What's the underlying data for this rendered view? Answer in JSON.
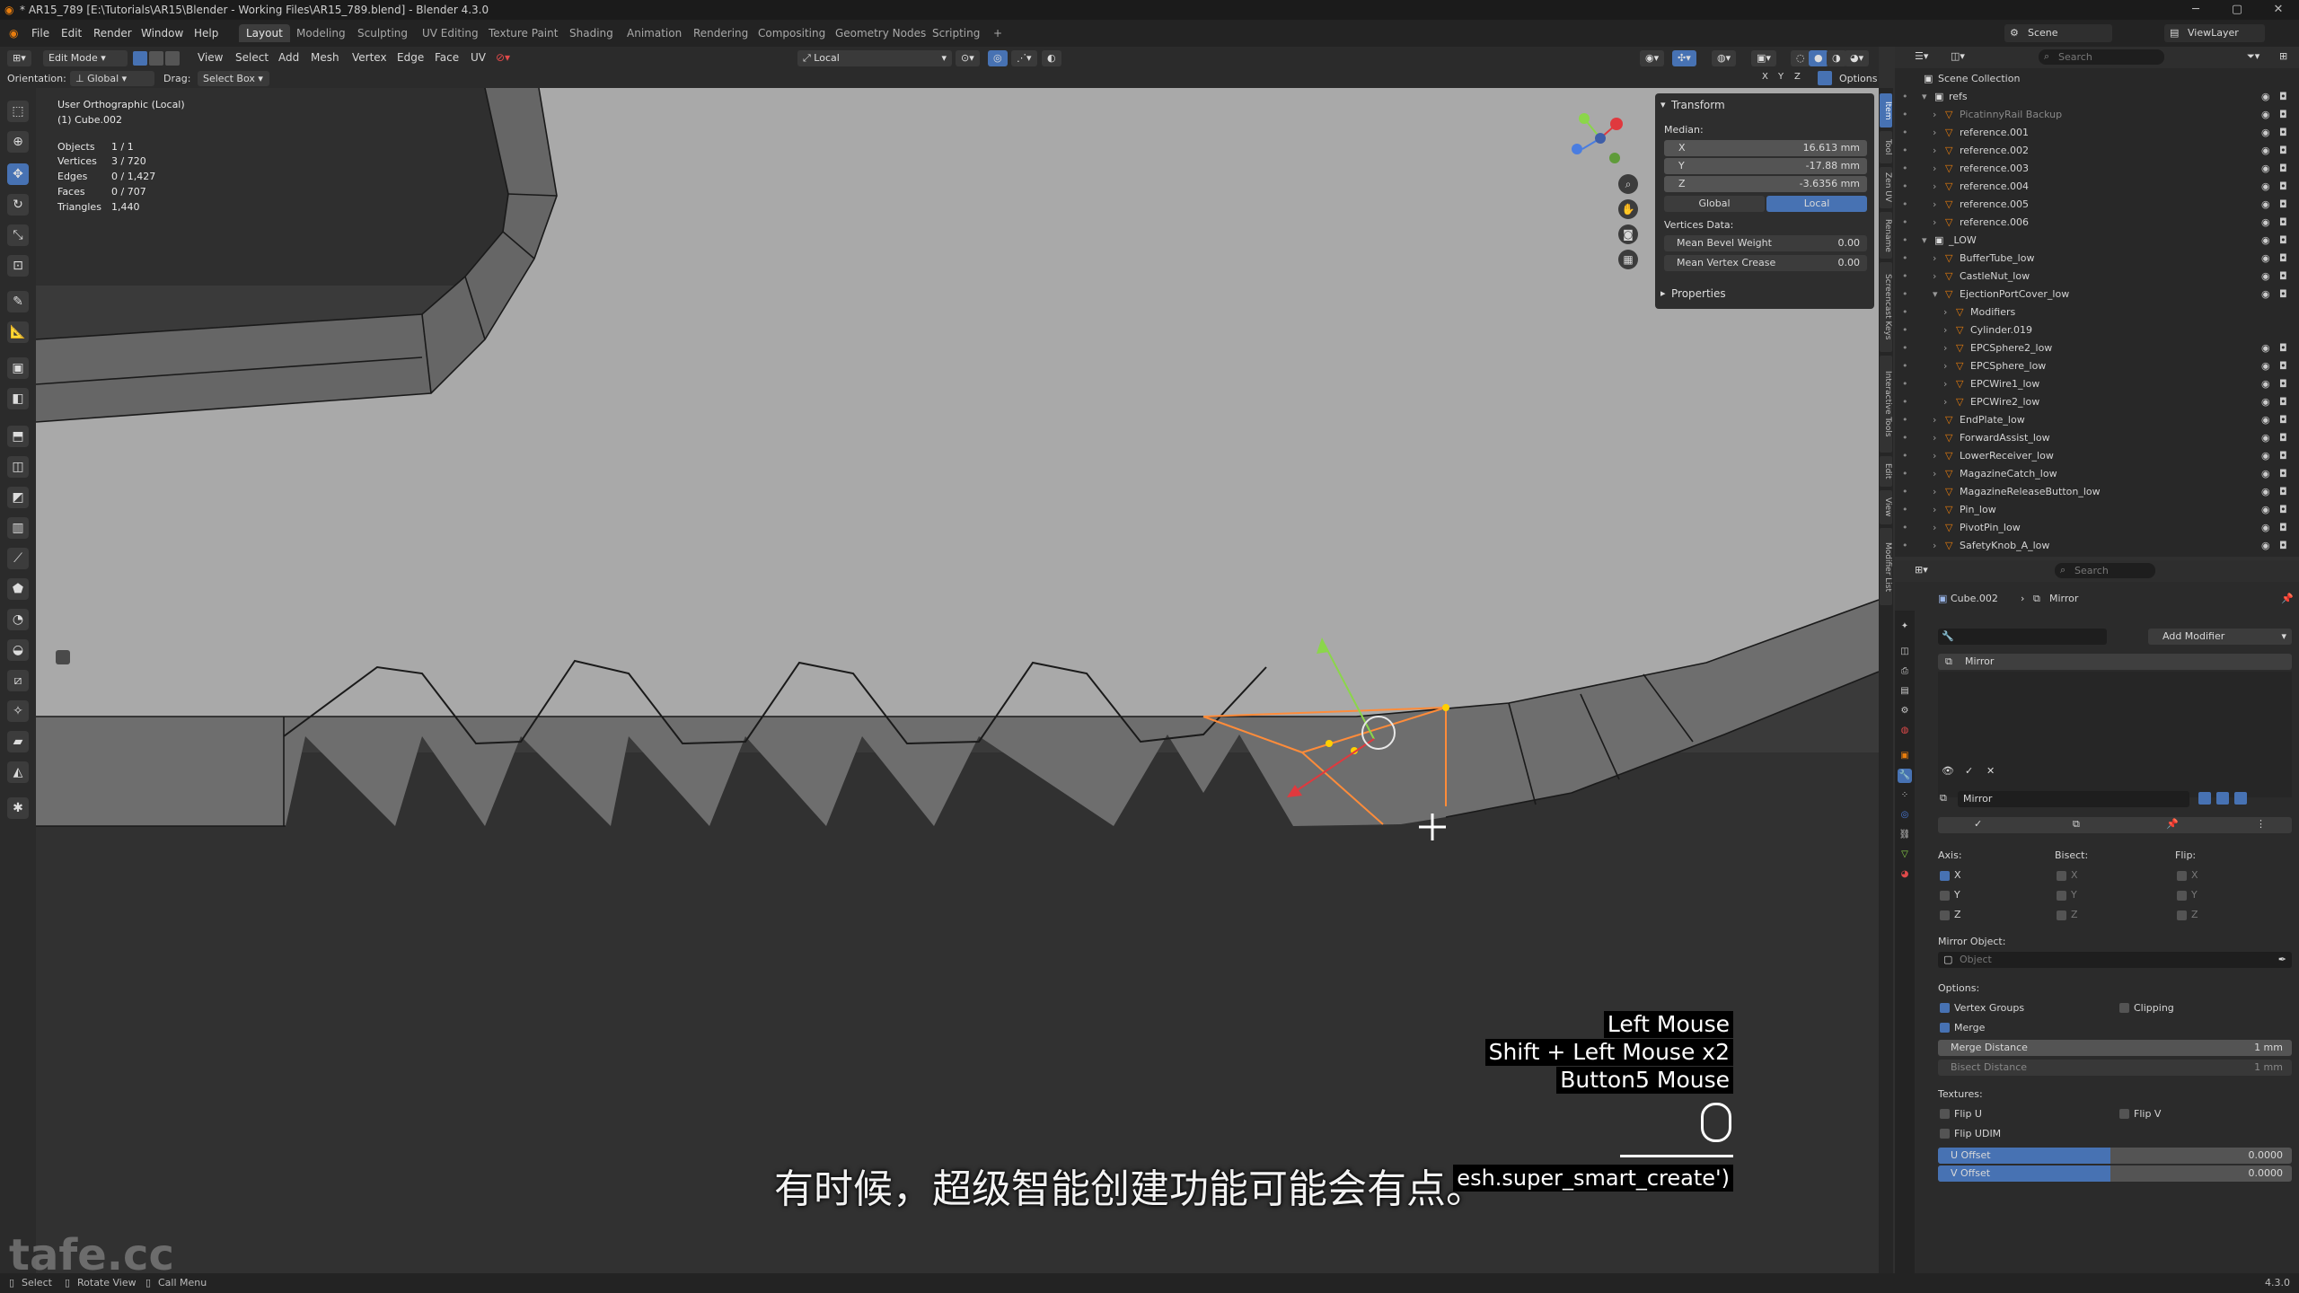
{
  "titlebar": {
    "title": "* AR15_789 [E:\\Tutorials\\AR15\\Blender - Working Files\\AR15_789.blend] - Blender 4.3.0"
  },
  "menu": {
    "items": [
      "File",
      "Edit",
      "Render",
      "Window",
      "Help"
    ]
  },
  "workspaces": [
    "Layout",
    "Modeling",
    "Sculpting",
    "UV Editing",
    "Texture Paint",
    "Shading",
    "Animation",
    "Rendering",
    "Compositing",
    "Geometry Nodes",
    "Scripting",
    "+"
  ],
  "topright": {
    "scene": "Scene",
    "viewlayer": "ViewLayer"
  },
  "header": {
    "mode": "Edit Mode",
    "menus": [
      "View",
      "Select",
      "Add",
      "Mesh",
      "Vertex",
      "Edge",
      "Face",
      "UV"
    ],
    "orientation_label": "Orientation:",
    "orientation": "Global",
    "drag_label": "Drag:",
    "drag": "Select Box",
    "pivot": "Local",
    "options": "Options",
    "axes": [
      "X",
      "Y",
      "Z"
    ]
  },
  "overlay": {
    "view_name": "User Orthographic (Local)",
    "object_name": "(1) Cube.002",
    "stats": [
      {
        "label": "Objects",
        "value": "1 / 1"
      },
      {
        "label": "Vertices",
        "value": "3 / 720"
      },
      {
        "label": "Edges",
        "value": "0 / 1,427"
      },
      {
        "label": "Faces",
        "value": "0 / 707"
      },
      {
        "label": "Triangles",
        "value": "1,440"
      }
    ]
  },
  "npanel": {
    "transform": "Transform",
    "median": "Median:",
    "x_label": "X",
    "x": "16.613 mm",
    "y_label": "Y",
    "y": "-17.88 mm",
    "z_label": "Z",
    "z": "-3.6356 mm",
    "global": "Global",
    "local": "Local",
    "vertices_data": "Vertices Data:",
    "bevel_label": "Mean Bevel Weight",
    "bevel": "0.00",
    "crease_label": "Mean Vertex Crease",
    "crease": "0.00",
    "properties": "Properties"
  },
  "sidetabs": [
    "Item",
    "Tool",
    "Zen UV",
    "Rename",
    "Screencast Keys",
    "Interactive Tools",
    "Edit",
    "View",
    "Modifier List"
  ],
  "outliner": {
    "search_placeholder": "Search",
    "rows": [
      {
        "name": "Scene Collection",
        "indent": 0
      },
      {
        "name": "refs",
        "indent": 1
      },
      {
        "name": "PicatinnyRail Backup",
        "indent": 2
      },
      {
        "name": "reference.001",
        "indent": 2
      },
      {
        "name": "reference.002",
        "indent": 2
      },
      {
        "name": "reference.003",
        "indent": 2
      },
      {
        "name": "reference.004",
        "indent": 2
      },
      {
        "name": "reference.005",
        "indent": 2
      },
      {
        "name": "reference.006",
        "indent": 2
      },
      {
        "name": "_LOW",
        "indent": 1
      },
      {
        "name": "BufferTube_low",
        "indent": 2
      },
      {
        "name": "CastleNut_low",
        "indent": 2
      },
      {
        "name": "EjectionPortCover_low",
        "indent": 2
      },
      {
        "name": "Modifiers",
        "indent": 3
      },
      {
        "name": "Cylinder.019",
        "indent": 3
      },
      {
        "name": "EPCSphere2_low",
        "indent": 3
      },
      {
        "name": "EPCSphere_low",
        "indent": 3
      },
      {
        "name": "EPCWire1_low",
        "indent": 3
      },
      {
        "name": "EPCWire2_low",
        "indent": 3
      },
      {
        "name": "EndPlate_low",
        "indent": 2
      },
      {
        "name": "ForwardAssist_low",
        "indent": 2
      },
      {
        "name": "LowerReceiver_low",
        "indent": 2
      },
      {
        "name": "MagazineCatch_low",
        "indent": 2
      },
      {
        "name": "MagazineReleaseButton_low",
        "indent": 2
      },
      {
        "name": "Pin_low",
        "indent": 2
      },
      {
        "name": "PivotPin_low",
        "indent": 2
      },
      {
        "name": "SafetyKnob_A_low",
        "indent": 2
      }
    ]
  },
  "properties": {
    "search_placeholder": "Search",
    "breadcrumb_object": "Cube.002",
    "breadcrumb_modifier": "Mirror",
    "add_modifier": "Add Modifier",
    "modifier_list_item": "Mirror",
    "modifier_name": "Mirror",
    "axis_label": "Axis:",
    "bisect_label": "Bisect:",
    "flip_label": "Flip:",
    "axes": [
      "X",
      "Y",
      "Z"
    ],
    "axis_checked": [
      true,
      false,
      false
    ],
    "mirror_object_label": "Mirror Object:",
    "object_placeholder": "Object",
    "options_label": "Options:",
    "vertex_groups": "Vertex Groups",
    "clipping": "Clipping",
    "merge": "Merge",
    "merge_distance_label": "Merge Distance",
    "merge_distance": "1 mm",
    "bisect_distance_label": "Bisect Distance",
    "bisect_distance": "1 mm",
    "textures_label": "Textures:",
    "flip_u": "Flip U",
    "flip_v": "Flip V",
    "flip_udim": "Flip UDIM",
    "u_offset_label": "U Offset",
    "u_offset": "0.0000",
    "v_offset_label": "V Offset",
    "v_offset": "0.0000"
  },
  "statusbar": {
    "select": "Select",
    "rotate": "Rotate View",
    "call_menu": "Call Menu",
    "version": "4.3.0"
  },
  "captions": {
    "keys": [
      "Left Mouse",
      "Shift + Left Mouse x2",
      "Button5 Mouse"
    ],
    "operator": "esh.super_smart_create')",
    "subtitle": "有时候，超级智能创建功能可能会有点。",
    "watermark": "tafe.cc"
  },
  "colors": {
    "accent": "#4772b3",
    "selection": "#ff8c3a",
    "background": "#303030"
  }
}
